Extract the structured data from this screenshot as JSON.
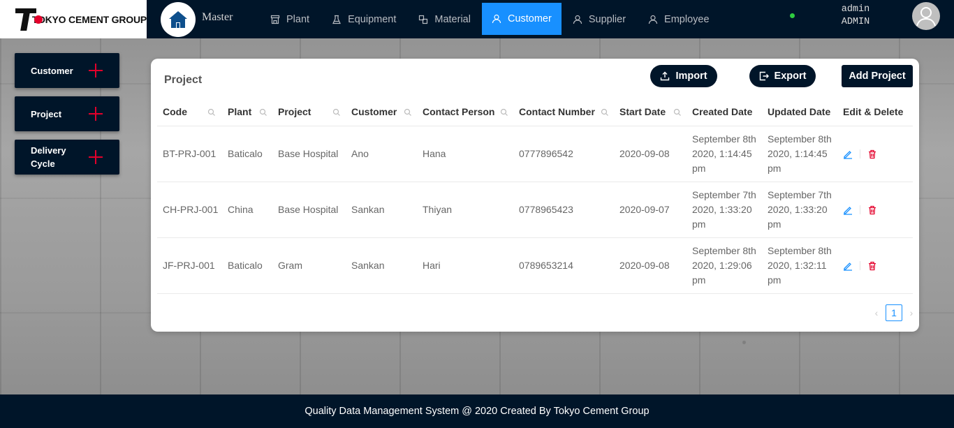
{
  "brand": {
    "logo_text": "TOKYO CEMENT GROUP",
    "section_title": "Master"
  },
  "nav": {
    "items": [
      {
        "label": "Plant",
        "icon": "shop-icon"
      },
      {
        "label": "Equipment",
        "icon": "experiment-icon"
      },
      {
        "label": "Material",
        "icon": "block-icon"
      },
      {
        "label": "Customer",
        "icon": "user-icon",
        "active": true
      },
      {
        "label": "Supplier",
        "icon": "user-icon"
      },
      {
        "label": "Employee",
        "icon": "user-icon"
      }
    ],
    "active_color": "#1890ff",
    "bg_color": "#001529"
  },
  "user": {
    "name": "admin",
    "role": "ADMIN",
    "status_color": "#2ecc40"
  },
  "sidebar": {
    "items": [
      {
        "label": "Customer"
      },
      {
        "label": "Project"
      },
      {
        "label": "Delivery Cycle"
      }
    ],
    "plus_color": "#e4002b"
  },
  "card": {
    "title": "Project",
    "import_label": "Import",
    "export_label": "Export",
    "add_label": "Add Project"
  },
  "table": {
    "headers": [
      "Code",
      "Plant",
      "Project",
      "Customer",
      "Contact Person",
      "Contact Number",
      "Start Date",
      "Created Date",
      "Updated Date",
      "Edit & Delete"
    ],
    "rows": [
      {
        "code": "BT-PRJ-001",
        "plant": "Baticalo",
        "project": "Base Hospital",
        "customer": "Ano",
        "contact_person": "Hana",
        "contact_number": "0777896542",
        "start_date": "2020-09-08",
        "created_date": "September 8th 2020, 1:14:45 pm",
        "updated_date": "September 8th 2020, 1:14:45 pm"
      },
      {
        "code": "CH-PRJ-001",
        "plant": "China",
        "project": "Base Hospital",
        "customer": "Sankan",
        "contact_person": "Thiyan",
        "contact_number": "0778965423",
        "start_date": "2020-09-07",
        "created_date": "September 7th 2020, 1:33:20 pm",
        "updated_date": "September 7th 2020, 1:33:20 pm"
      },
      {
        "code": "JF-PRJ-001",
        "plant": "Baticalo",
        "project": "Gram",
        "customer": "Sankan",
        "contact_person": "Hari",
        "contact_number": "0789653214",
        "start_date": "2020-09-08",
        "created_date": "September 8th 2020, 1:29:06 pm",
        "updated_date": "September 8th 2020, 1:32:11 pm"
      }
    ],
    "edit_color": "#1890ff",
    "delete_color": "#e4002b"
  },
  "pagination": {
    "current": "1"
  },
  "footer": {
    "text": "Quality Data Management System @ 2020 Created By Tokyo Cement Group"
  }
}
